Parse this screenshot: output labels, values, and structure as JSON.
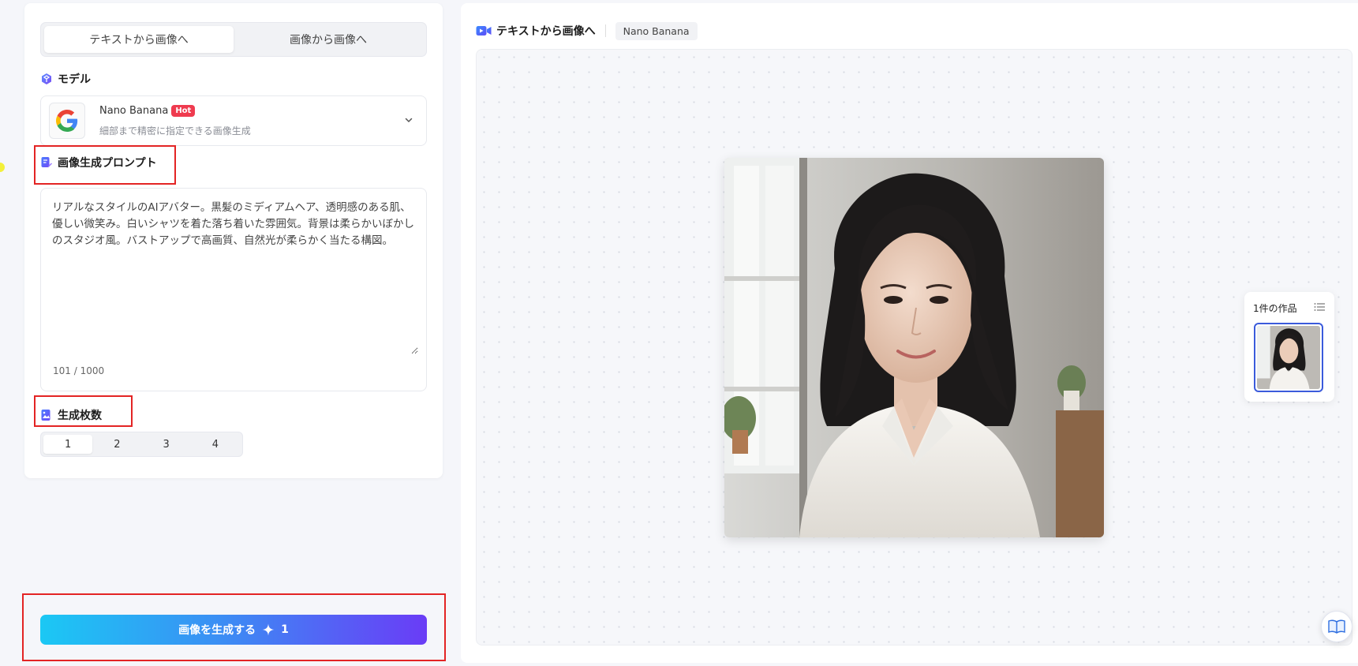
{
  "mode_tabs": [
    {
      "label": "テキストから画像へ",
      "active": true
    },
    {
      "label": "画像から画像へ",
      "active": false
    }
  ],
  "model_section": {
    "label": "モデル",
    "model_name": "Nano Banana",
    "badge": "Hot",
    "description": "細部まで精密に指定できる画像生成"
  },
  "prompt_section": {
    "label": "画像生成プロンプト",
    "value": "リアルなスタイルのAIアバター。黒髪のミディアムヘア、透明感のある肌、優しい微笑み。白いシャツを着た落ち着いた雰囲気。背景は柔らかいぼかしのスタジオ風。バストアップで高画質、自然光が柔らかく当たる構図。",
    "char_count": "101 / 1000"
  },
  "count_section": {
    "label": "生成枚数",
    "options": [
      "1",
      "2",
      "3",
      "4"
    ],
    "selected": "1"
  },
  "generate_button": {
    "label": "画像を生成する",
    "credits": "1"
  },
  "preview": {
    "title": "テキストから画像へ",
    "model_tag": "Nano Banana"
  },
  "gallery": {
    "title": "1件の作品"
  },
  "colors": {
    "accent": "#3b5bdb",
    "annotation": "#e32424",
    "hot_badge": "#ef3b4f",
    "gradient_start": "#1bc8f4",
    "gradient_end": "#6a3cf6"
  },
  "icons": {
    "model": "model-hexagon-icon",
    "prompt": "prompt-edit-icon",
    "count": "image-count-icon",
    "preview": "video-camera-icon",
    "gallery_list": "list-icon",
    "guide": "book-icon",
    "sparkle": "sparkle-icon",
    "dropdown": "chevron-down-icon"
  }
}
